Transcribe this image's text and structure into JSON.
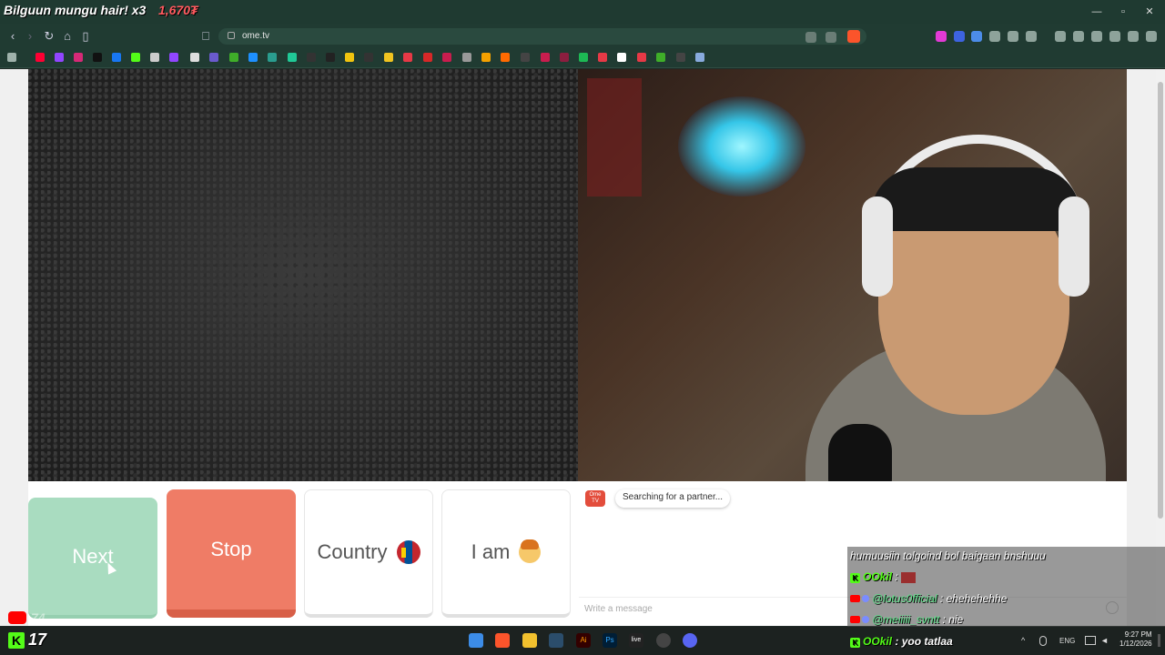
{
  "stream_overlay": {
    "title": "Bilguun mungu hair! x3",
    "coins": "1,670₮",
    "kick_viewers": "17",
    "youtube_viewers": "74"
  },
  "browser": {
    "url": "ome.tv",
    "accent_color": "#203b32"
  },
  "ometv": {
    "next_label": "Next",
    "stop_label": "Stop",
    "country_label": "Country",
    "iam_label": "I am",
    "logo_text": "Ome TV",
    "status_message": "Searching for a partner...",
    "message_placeholder": "Write a message",
    "colors": {
      "next": "#a9dcc0",
      "stop": "#ef7c66"
    }
  },
  "overlay_chat": [
    {
      "text": "humuusiin tolgoind bol baigaan bnshuuu"
    },
    {
      "user": "OOkil",
      "sep": " : ",
      "platform": "kick"
    },
    {
      "user": "@lotus0fficial",
      "sep": " : ",
      "text": "ehehehehhe",
      "platform": "youtube"
    },
    {
      "user": "@meiiiii_svntt",
      "sep": " : ",
      "text": "nie",
      "platform": "youtube"
    },
    {
      "user": "OOkil",
      "sep": " : ",
      "text": "yoo tatlaa",
      "platform": "kick"
    }
  ],
  "taskbar": {
    "language": "ENG",
    "time": "9:27 PM",
    "date": "1/12/2026"
  }
}
